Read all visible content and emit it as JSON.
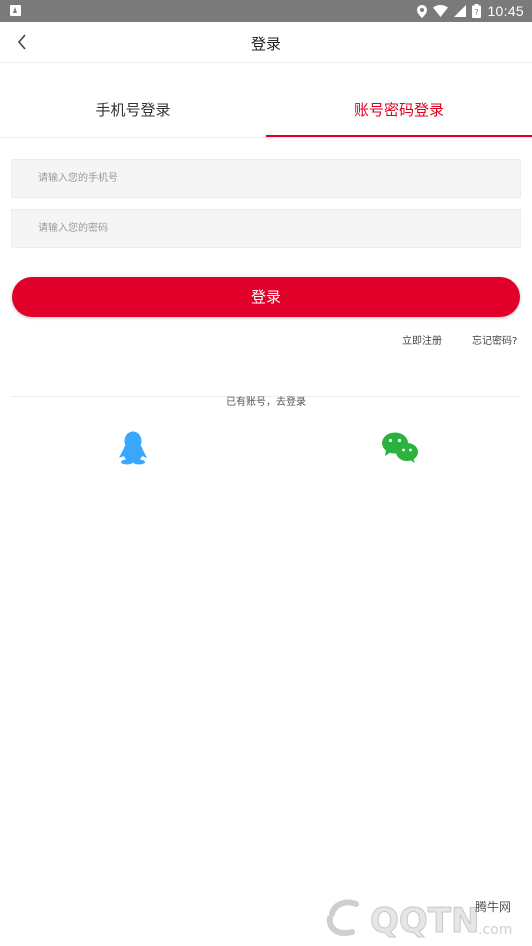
{
  "status_bar": {
    "time": "10:45",
    "icons": [
      "notification-icon",
      "location-icon",
      "wifi-icon",
      "signal-icon",
      "battery-icon"
    ]
  },
  "nav": {
    "title": "登录",
    "back_icon": "chevron-left-icon"
  },
  "tabs": [
    {
      "label": "手机号登录",
      "active": false
    },
    {
      "label": "账号密码登录",
      "active": true
    }
  ],
  "form": {
    "phone": {
      "placeholder": "请输入您的手机号",
      "value": ""
    },
    "password": {
      "placeholder": "请输入您的密码",
      "value": ""
    },
    "submit_label": "登录"
  },
  "links": {
    "register": "立即注册",
    "forgot": "忘记密码?"
  },
  "divider_text": "已有账号，去登录",
  "social": [
    {
      "name": "qq-icon",
      "color": "#3aa7ff"
    },
    {
      "name": "wechat-icon",
      "color": "#2bb13d"
    }
  ],
  "watermark": {
    "text": "腾牛网",
    "logo_text": "QQTN.com"
  },
  "colors": {
    "accent": "#e0001f",
    "button": "#e0002a",
    "status_bar": "#7a7a7a"
  }
}
